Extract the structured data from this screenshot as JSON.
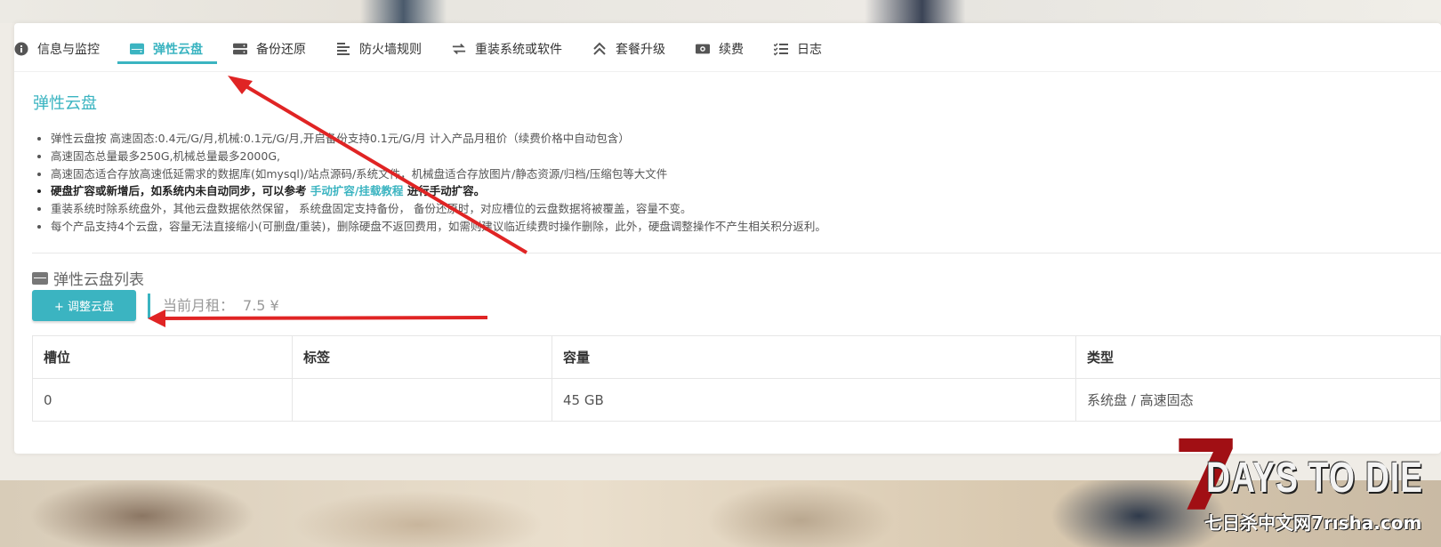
{
  "tabs": [
    {
      "label": "信息与监控",
      "icon": "info-icon",
      "active": false
    },
    {
      "label": "弹性云盘",
      "icon": "disk-icon",
      "active": true
    },
    {
      "label": "备份还原",
      "icon": "server-icon",
      "active": false
    },
    {
      "label": "防火墙规则",
      "icon": "list-icon",
      "active": false
    },
    {
      "label": "重装系统或软件",
      "icon": "swap-icon",
      "active": false
    },
    {
      "label": "套餐升级",
      "icon": "upgrade-icon",
      "active": false
    },
    {
      "label": "续费",
      "icon": "money-icon",
      "active": false
    },
    {
      "label": "日志",
      "icon": "checklist-icon",
      "active": false
    }
  ],
  "section": {
    "title": "弹性云盘",
    "notes": [
      "弹性云盘按 高速固态:0.4元/G/月,机械:0.1元/G/月,开启备份支持0.1元/G/月 计入产品月租价（续费价格中自动包含）",
      "高速固态总量最多250G,机械总量最多2000G,",
      "高速固态适合存放高速低延需求的数据库(如mysql)/站点源码/系统文件，机械盘适合存放图片/静态资源/归档/压缩包等大文件",
      "",
      "重装系统时除系统盘外，其他云盘数据依然保留， 系统盘固定支持备份， 备份还原时，对应槽位的云盘数据将被覆盖，容量不变。",
      "每个产品支持4个云盘，容量无法直接缩小(可删盘/重装)，删除硬盘不返回费用，如需则建议临近续费时操作删除，此外，硬盘调整操作不产生相关积分返利。"
    ],
    "bold_note": {
      "prefix": "硬盘扩容或新增后，如系统内未自动同步，可以参考 ",
      "link": "手动扩容/挂载教程",
      "suffix": " 进行手动扩容。"
    }
  },
  "disk_list": {
    "title": "弹性云盘列表",
    "adjust_button": "+ 调整云盘",
    "rent_label": "当前月租：",
    "rent_value": "7.5 ¥",
    "columns": [
      "槽位",
      "标签",
      "容量",
      "类型"
    ],
    "rows": [
      [
        "0",
        "",
        "45 GB",
        "系统盘 / 高速固态"
      ]
    ]
  },
  "watermark": {
    "big": "7",
    "title": "DAYS TO DIE",
    "site": "七日杀中文网7rısha.com"
  },
  "colors": {
    "accent": "#3bb4c1",
    "arrow": "#e02424"
  }
}
